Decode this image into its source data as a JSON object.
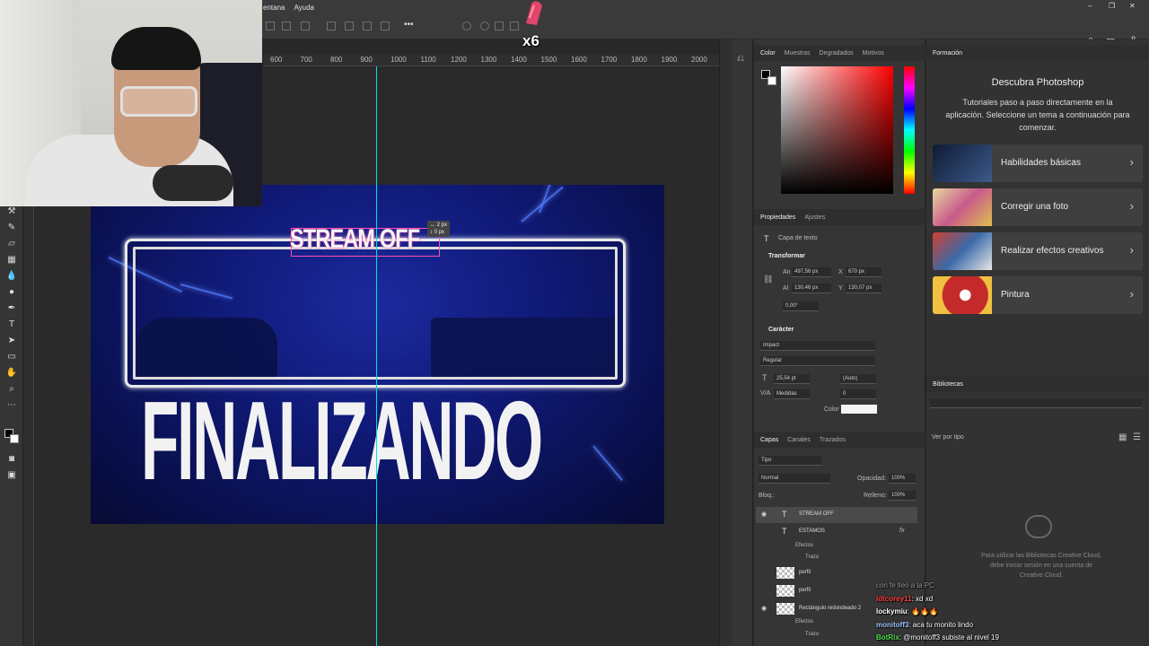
{
  "menu": {
    "ventana": "entana",
    "ayuda": "Ayuda"
  },
  "sticker": {
    "label": "x6"
  },
  "ruler": {
    "marks": [
      "600",
      "700",
      "800",
      "900",
      "1000",
      "1100",
      "1200",
      "1300",
      "1400",
      "1500",
      "1600",
      "1700",
      "1800",
      "1900",
      "2000"
    ]
  },
  "artwork": {
    "stream_off": "STREAM OFF",
    "finalizando": "FINALIZANDO",
    "tooltip_line1": "↔ 2 px",
    "tooltip_line2": "↕ 0 px"
  },
  "color_panel": {
    "tabs": [
      "Color",
      "Muestras",
      "Degradados",
      "Motivos"
    ]
  },
  "properties": {
    "tabs": [
      "Propiedades",
      "Ajustes"
    ],
    "layer_type": "Capa de texto",
    "transform_title": "Transformar",
    "an": "An",
    "an_value": "497,56 px",
    "x": "X",
    "x_value": "670 px",
    "al": "Al",
    "al_value": "130,46 px",
    "y": "Y",
    "y_value": "130,07 px",
    "angle_value": "0,00°",
    "character_title": "Carácter",
    "font": "Impact",
    "style": "Regular",
    "size": "25,54 pt",
    "leading": "(Auto)",
    "kerning": "Medidas",
    "tracking": "0",
    "color_label": "Color"
  },
  "layers": {
    "tabs": [
      "Capas",
      "Canales",
      "Trazados"
    ],
    "filter": "Tipo",
    "blend": "Normal",
    "opacity_label": "Opacidad:",
    "opacity": "100%",
    "lock_label": "Bloq.:",
    "fill_label": "Relleno:",
    "fill": "100%",
    "items": [
      {
        "name": "STREAM OFF",
        "kind": "text",
        "selected": true
      },
      {
        "name": "ESTAMOS",
        "kind": "text",
        "selected": false
      },
      {
        "name": "perfil",
        "kind": "image",
        "selected": false
      },
      {
        "name": "perfil",
        "kind": "image",
        "selected": false
      },
      {
        "name": "Rectángulo redondeado 2",
        "kind": "shape",
        "selected": false
      }
    ],
    "effects": "Efectos",
    "stroke": "Trazo"
  },
  "learn": {
    "tab": "Formación",
    "title": "Descubra Photoshop",
    "desc": "Tutoriales paso a paso directamente en la aplicación. Seleccione un tema a continuación para comenzar.",
    "cards": [
      {
        "label": "Habilidades básicas",
        "color": "#1d2a4a"
      },
      {
        "label": "Corregir una foto",
        "color": "#c9a455"
      },
      {
        "label": "Realizar efectos creativos",
        "color": "#3a6aa8"
      },
      {
        "label": "Pintura",
        "color": "#c42a2a"
      }
    ]
  },
  "libraries": {
    "tab": "Bibliotecas",
    "view": "Ver por tipo",
    "message": "Para utilizar las Bibliotecas Creative Cloud, debe iniciar sesión en una cuenta de Creative Cloud."
  },
  "chat": [
    {
      "user": "",
      "text": "con fe lleo a la PC",
      "color": "#9a9a9a"
    },
    {
      "user": "ldtcorey11",
      "text": ": xd xd",
      "color": "#ff4040"
    },
    {
      "user": "lockymiu",
      "text": ": 🔥🔥🔥",
      "color": "#ffffff"
    },
    {
      "user": "monitoff3",
      "text": ": aca tu monito lindo",
      "color": "#a0c8ff"
    },
    {
      "user": "BotRix",
      "text": ": @monitoff3 subiste al nivel 19",
      "color": "#50e050"
    }
  ]
}
